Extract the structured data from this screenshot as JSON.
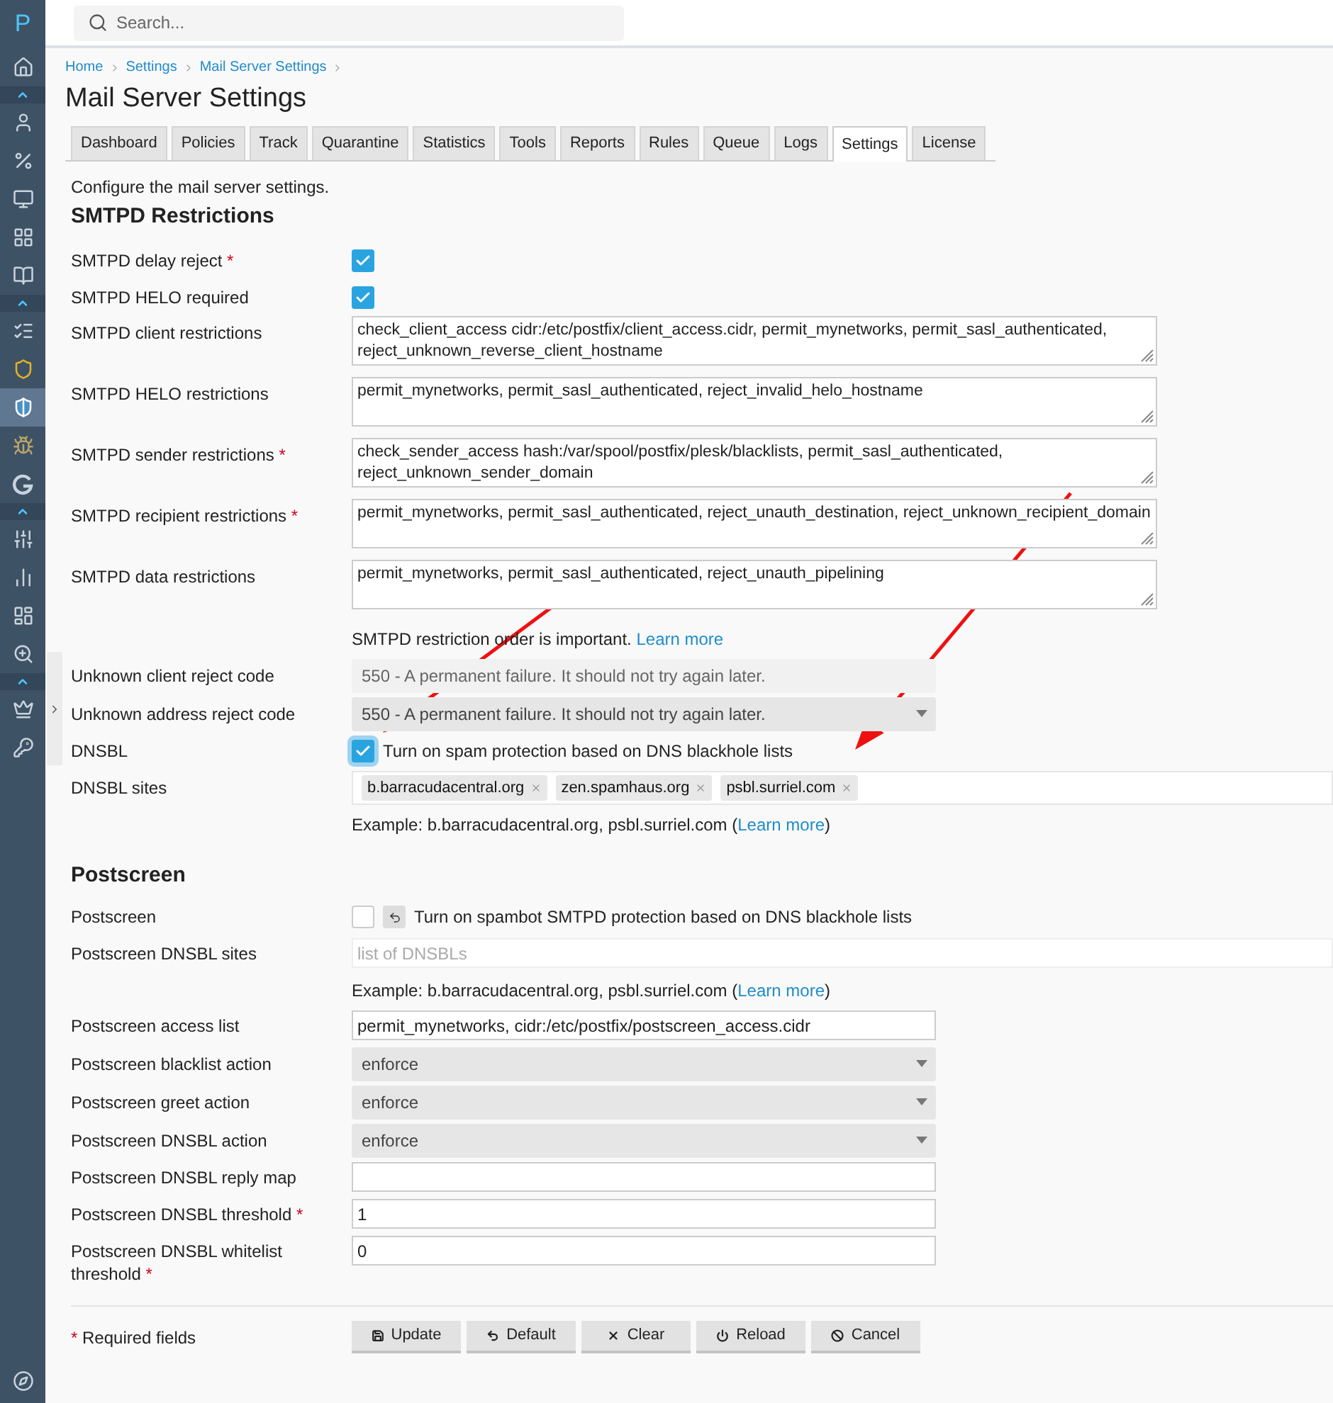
{
  "sidebar": {
    "logo": "P",
    "items": [
      {
        "kind": "link",
        "selected": false
      },
      {
        "kind": "toggle",
        "selected": false
      },
      {
        "kind": "link",
        "selected": false
      },
      {
        "kind": "link",
        "selected": false
      },
      {
        "kind": "link",
        "selected": false
      },
      {
        "kind": "link",
        "selected": false
      },
      {
        "kind": "link",
        "selected": false
      },
      {
        "kind": "toggle",
        "selected": false
      },
      {
        "kind": "link",
        "selected": false
      },
      {
        "kind": "link",
        "selected": false
      },
      {
        "kind": "link",
        "selected": true
      },
      {
        "kind": "link",
        "selected": false
      },
      {
        "kind": "link",
        "selected": false
      },
      {
        "kind": "toggle",
        "selected": false
      },
      {
        "kind": "link",
        "selected": false
      },
      {
        "kind": "link",
        "selected": false
      },
      {
        "kind": "link",
        "selected": false
      },
      {
        "kind": "link",
        "selected": false
      },
      {
        "kind": "toggle",
        "selected": false
      },
      {
        "kind": "link",
        "selected": false
      },
      {
        "kind": "link",
        "selected": false
      }
    ]
  },
  "search": {
    "placeholder": "Search..."
  },
  "breadcrumb": [
    "Home",
    "Settings",
    "Mail Server Settings"
  ],
  "title": "Mail Server Settings",
  "tabs": [
    {
      "label": "Dashboard",
      "selected": false
    },
    {
      "label": "Policies",
      "selected": false
    },
    {
      "label": "Track",
      "selected": false
    },
    {
      "label": "Quarantine",
      "selected": false
    },
    {
      "label": "Statistics",
      "selected": false
    },
    {
      "label": "Tools",
      "selected": false
    },
    {
      "label": "Reports",
      "selected": false
    },
    {
      "label": "Rules",
      "selected": false
    },
    {
      "label": "Queue",
      "selected": false
    },
    {
      "label": "Logs",
      "selected": false
    },
    {
      "label": "Settings",
      "selected": true
    },
    {
      "label": "License",
      "selected": false
    }
  ],
  "intro": "Configure the mail server settings.",
  "sections": [
    {
      "heading": "SMTPD Restrictions",
      "rows": [
        {
          "kind": "checkbox",
          "label": "SMTPD delay reject",
          "mark": "*",
          "checked": true
        },
        {
          "kind": "checkbox",
          "label": "SMTPD HELO required",
          "checked": true
        },
        {
          "kind": "textarea",
          "label": "SMTPD client restrictions",
          "value": "check_client_access cidr:/etc/postfix/client_access.cidr, permit_mynetworks, permit_sasl_authenticated, reject_unknown_reverse_client_hostname"
        },
        {
          "kind": "textarea",
          "label": "SMTPD HELO restrictions",
          "value": "permit_mynetworks, permit_sasl_authenticated, reject_invalid_helo_hostname"
        },
        {
          "kind": "textarea",
          "label": "SMTPD sender restrictions",
          "mark": "*",
          "value": "check_sender_access hash:/var/spool/postfix/plesk/blacklists, permit_sasl_authenticated, reject_unknown_sender_domain"
        },
        {
          "kind": "textarea",
          "label": "SMTPD recipient restrictions",
          "mark": "*",
          "value": "permit_mynetworks, permit_sasl_authenticated, reject_unauth_destination, reject_unknown_recipient_domain"
        },
        {
          "kind": "textarea",
          "label": "SMTPD data restrictions",
          "value": "permit_mynetworks, permit_sasl_authenticated, reject_unauth_pipelining"
        },
        {
          "kind": "note",
          "text": "SMTPD restriction order is important. ",
          "link": "Learn more"
        },
        {
          "kind": "select",
          "label": "Unknown client reject code",
          "value": "550 - A permanent failure. It should not try again later.",
          "disabled": true
        },
        {
          "kind": "select",
          "label": "Unknown address reject code",
          "value": "550 - A permanent failure. It should not try again later.",
          "disabled": false
        },
        {
          "kind": "checkbox",
          "label": "DNSBL",
          "checked": true,
          "focused": true,
          "text": "Turn on spam protection based on DNS blackhole lists"
        },
        {
          "kind": "tags",
          "label": "DNSBL sites",
          "tags": [
            "b.barracudacentral.org",
            "zen.spamhaus.org",
            "psbl.surriel.com"
          ]
        },
        {
          "kind": "note",
          "text": "Example: b.barracudacentral.org, psbl.surriel.com (",
          "link": "Learn more",
          "suffix": ")"
        }
      ]
    },
    {
      "heading": "Postscreen",
      "rows": [
        {
          "kind": "checkbox",
          "label": "Postscreen",
          "checked": false,
          "reset": true,
          "text": "Turn on spambot SMTPD protection based on DNS blackhole lists"
        },
        {
          "kind": "input",
          "label": "Postscreen DNSBL sites",
          "placeholder": "list of DNSBLs",
          "wide": true
        },
        {
          "kind": "note",
          "text": "Example: b.barracudacentral.org, psbl.surriel.com (",
          "link": "Learn more",
          "suffix": ")"
        },
        {
          "kind": "input",
          "label": "Postscreen access list",
          "value": "permit_mynetworks, cidr:/etc/postfix/postscreen_access.cidr"
        },
        {
          "kind": "select",
          "label": "Postscreen blacklist action",
          "value": "enforce",
          "disabled": false
        },
        {
          "kind": "select",
          "label": "Postscreen greet action",
          "value": "enforce",
          "disabled": false
        },
        {
          "kind": "select",
          "label": "Postscreen DNSBL action",
          "value": "enforce",
          "disabled": false
        },
        {
          "kind": "input",
          "label": "Postscreen DNSBL reply map"
        },
        {
          "kind": "input",
          "label": "Postscreen DNSBL threshold",
          "mark": "*",
          "value": "1"
        },
        {
          "kind": "input",
          "label": "Postscreen DNSBL whitelist threshold",
          "mark": "*",
          "value": "0"
        }
      ]
    }
  ],
  "footer": {
    "mark": "*",
    "text": "Required fields",
    "buttons": [
      "Update",
      "Default",
      "Clear",
      "Reload",
      "Cancel"
    ]
  }
}
